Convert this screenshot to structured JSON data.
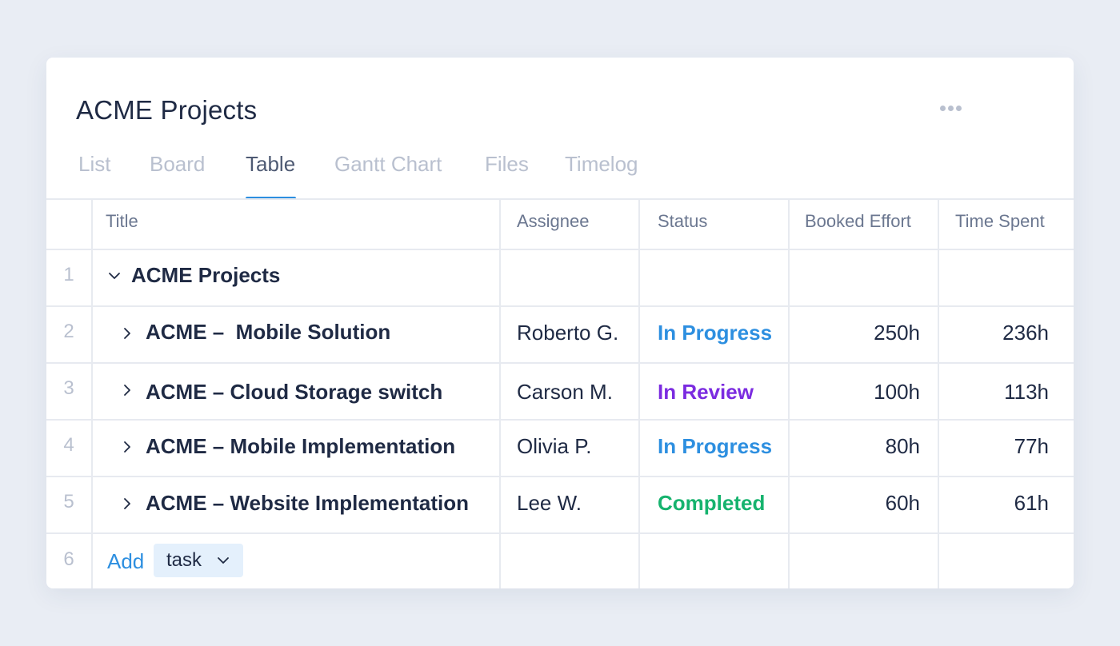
{
  "card": {
    "title": "ACME Projects",
    "more_icon": "more-horizontal-icon"
  },
  "tabs": [
    {
      "label": "List",
      "active": false
    },
    {
      "label": "Board",
      "active": false
    },
    {
      "label": "Table",
      "active": true
    },
    {
      "label": "Gantt Chart",
      "active": false
    },
    {
      "label": "Files",
      "active": false
    },
    {
      "label": "Timelog",
      "active": false
    }
  ],
  "table": {
    "columns": [
      "Title",
      "Assignee",
      "Status",
      "Booked Effort",
      "Time Spent"
    ],
    "rows": [
      {
        "num": "1",
        "title": "ACME Projects",
        "expanded": true,
        "assignee": "",
        "status": "",
        "booked": "",
        "spent": ""
      },
      {
        "num": "2",
        "title": "ACME –  Mobile Solution",
        "expanded": false,
        "assignee": "Roberto G.",
        "status": "In Progress",
        "booked": "250h",
        "spent": "236h"
      },
      {
        "num": "3",
        "title": "ACME – Cloud Storage switch",
        "expanded": false,
        "assignee": "Carson M.",
        "status": "In Review",
        "booked": "100h",
        "spent": "113h"
      },
      {
        "num": "4",
        "title": "ACME – Mobile Implementation",
        "expanded": false,
        "assignee": "Olivia P.",
        "status": "In Progress",
        "booked": "80h",
        "spent": "77h"
      },
      {
        "num": "5",
        "title": "ACME – Website Implementation",
        "expanded": false,
        "assignee": "Lee W.",
        "status": "Completed",
        "booked": "60h",
        "spent": "61h"
      }
    ],
    "add_row": {
      "num": "6",
      "add_label": "Add",
      "type_label": "task"
    }
  },
  "colors": {
    "accent": "#2d8fe0",
    "status_in_progress": "#2d8fe0",
    "status_in_review": "#7b2be0",
    "status_completed": "#16b36e",
    "tab_inactive": "#b9c0cf",
    "tab_active": "#4e5a73"
  }
}
